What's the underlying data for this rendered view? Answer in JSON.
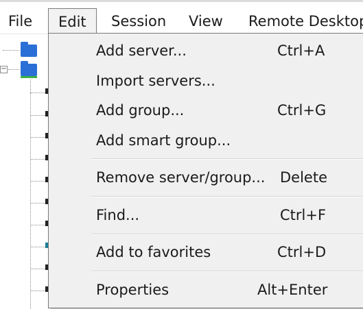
{
  "menubar": {
    "items": [
      {
        "label": "File"
      },
      {
        "label": "Edit"
      },
      {
        "label": "Session"
      },
      {
        "label": "View"
      },
      {
        "label": "Remote Desktop"
      }
    ]
  },
  "edit_menu": {
    "items": [
      {
        "label": "Add server...",
        "shortcut": "Ctrl+A"
      },
      {
        "label": "Import servers...",
        "shortcut": ""
      },
      {
        "label": "Add group...",
        "shortcut": "Ctrl+G"
      },
      {
        "label": "Add smart group...",
        "shortcut": ""
      },
      {
        "label": "Remove server/group...",
        "shortcut": "Delete"
      },
      {
        "label": "Find...",
        "shortcut": "Ctrl+F"
      },
      {
        "label": "Add to favorites",
        "shortcut": "Ctrl+D"
      },
      {
        "label": "Properties",
        "shortcut": "Alt+Enter"
      }
    ]
  },
  "tree": {
    "icons": [
      "folder-icon",
      "folder-icon"
    ]
  }
}
